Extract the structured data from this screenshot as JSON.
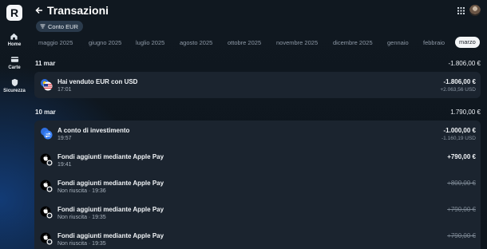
{
  "app": {
    "logo": "R"
  },
  "sidebar": {
    "items": [
      {
        "label": "Home",
        "icon": "home-icon"
      },
      {
        "label": "Carte",
        "icon": "card-icon"
      },
      {
        "label": "Sicurezza",
        "icon": "shield-icon"
      }
    ]
  },
  "header": {
    "title": "Transazioni",
    "back_icon": "arrow-left-icon",
    "grid_icon": "apps-grid-icon"
  },
  "filter": {
    "label": "Conto EUR",
    "icon": "filter-icon"
  },
  "months": [
    "maggio 2025",
    "giugno 2025",
    "luglio 2025",
    "agosto 2025",
    "ottobre 2025",
    "novembre 2025",
    "dicembre 2025",
    "gennaio",
    "febbraio",
    "marzo"
  ],
  "active_month": "marzo",
  "days": [
    {
      "date": "11 mar",
      "total": "-1.806,00 €",
      "transactions": [
        {
          "title": "Hai venduto EUR con USD",
          "subtitle": "17:01",
          "amount": "-1.806,00 €",
          "secondary": "+2.063,56 USD",
          "icon": "currency-exchange-flag-icon",
          "failed": false
        }
      ]
    },
    {
      "date": "10 mar",
      "total": "1.790,00 €",
      "transactions": [
        {
          "title": "A conto di investimento",
          "subtitle": "19:57",
          "amount": "-1.000,00 €",
          "secondary": "-1.160,19 USD",
          "icon": "transfer-icon",
          "failed": false
        },
        {
          "title": "Fondi aggiunti mediante Apple Pay",
          "subtitle": "19:41",
          "amount": "+790,00 €",
          "secondary": "",
          "icon": "apple-pay-icon",
          "failed": false
        },
        {
          "title": "Fondi aggiunti mediante Apple Pay",
          "subtitle": "Non riuscita · 19:36",
          "amount": "+800,00 €",
          "secondary": "",
          "icon": "apple-pay-icon",
          "failed": true
        },
        {
          "title": "Fondi aggiunti mediante Apple Pay",
          "subtitle": "Non riuscita · 19:35",
          "amount": "+790,00 €",
          "secondary": "",
          "icon": "apple-pay-icon",
          "failed": true
        },
        {
          "title": "Fondi aggiunti mediante Apple Pay",
          "subtitle": "Non riuscita · 19:35",
          "amount": "+790,00 €",
          "secondary": "",
          "icon": "apple-pay-icon",
          "failed": true
        }
      ]
    }
  ],
  "colors": {
    "accent_blue": "#2f6fe0",
    "card_bg": "#1b242f",
    "active_chip": "#f3f5f7"
  }
}
